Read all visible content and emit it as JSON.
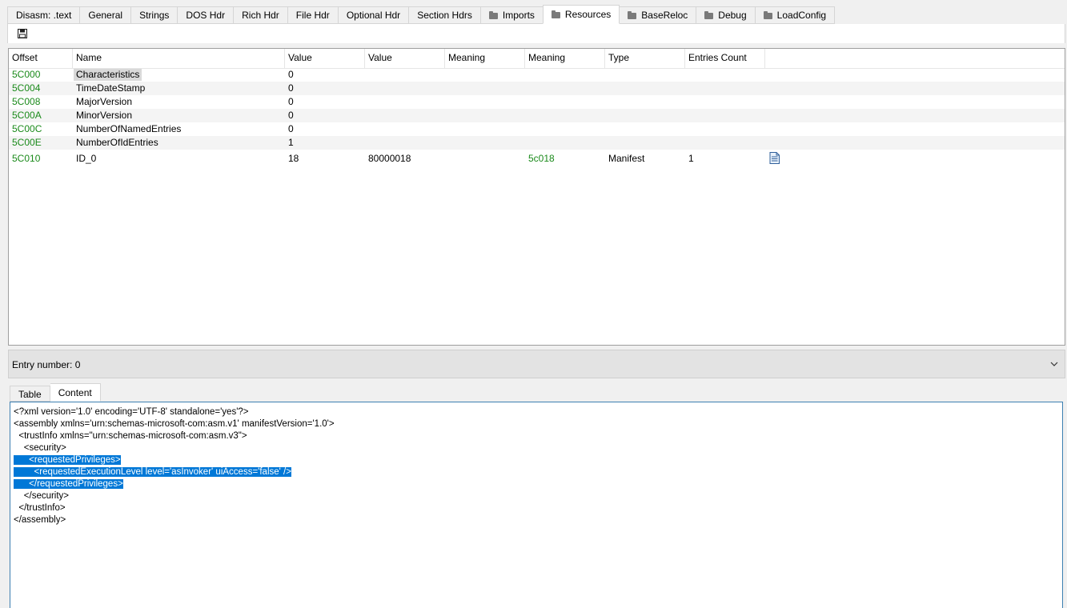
{
  "tabs": [
    {
      "label": "Disasm: .text",
      "folder": false,
      "active": false
    },
    {
      "label": "General",
      "folder": false,
      "active": false
    },
    {
      "label": "Strings",
      "folder": false,
      "active": false
    },
    {
      "label": "DOS Hdr",
      "folder": false,
      "active": false
    },
    {
      "label": "Rich Hdr",
      "folder": false,
      "active": false
    },
    {
      "label": "File Hdr",
      "folder": false,
      "active": false
    },
    {
      "label": "Optional Hdr",
      "folder": false,
      "active": false
    },
    {
      "label": "Section Hdrs",
      "folder": false,
      "active": false
    },
    {
      "label": "Imports",
      "folder": true,
      "active": false
    },
    {
      "label": "Resources",
      "folder": true,
      "active": true
    },
    {
      "label": "BaseReloc",
      "folder": true,
      "active": false
    },
    {
      "label": "Debug",
      "folder": true,
      "active": false
    },
    {
      "label": "LoadConfig",
      "folder": true,
      "active": false
    }
  ],
  "grid": {
    "columns": [
      "Offset",
      "Name",
      "Value",
      "Value",
      "Meaning",
      "Meaning",
      "Type",
      "Entries Count"
    ],
    "rows": [
      {
        "offset": "5C000",
        "name": "Characteristics",
        "value": "0",
        "value2": "",
        "meaning": "",
        "meaning2": "",
        "type": "",
        "entries": "",
        "icon": false,
        "selected": true
      },
      {
        "offset": "5C004",
        "name": "TimeDateStamp",
        "value": "0",
        "value2": "",
        "meaning": "",
        "meaning2": "",
        "type": "",
        "entries": "",
        "icon": false,
        "selected": false
      },
      {
        "offset": "5C008",
        "name": "MajorVersion",
        "value": "0",
        "value2": "",
        "meaning": "",
        "meaning2": "",
        "type": "",
        "entries": "",
        "icon": false,
        "selected": false
      },
      {
        "offset": "5C00A",
        "name": "MinorVersion",
        "value": "0",
        "value2": "",
        "meaning": "",
        "meaning2": "",
        "type": "",
        "entries": "",
        "icon": false,
        "selected": false
      },
      {
        "offset": "5C00C",
        "name": "NumberOfNamedEntries",
        "value": "0",
        "value2": "",
        "meaning": "",
        "meaning2": "",
        "type": "",
        "entries": "",
        "icon": false,
        "selected": false
      },
      {
        "offset": "5C00E",
        "name": "NumberOfIdEntries",
        "value": "1",
        "value2": "",
        "meaning": "",
        "meaning2": "",
        "type": "",
        "entries": "",
        "icon": false,
        "selected": false
      },
      {
        "offset": "5C010",
        "name": "ID_0",
        "value": "18",
        "value2": "80000018",
        "meaning": "",
        "meaning2": "5c018",
        "type": "Manifest",
        "entries": "1",
        "icon": true,
        "selected": false
      }
    ]
  },
  "entry": {
    "label": "Entry number: 0"
  },
  "subtabs": [
    {
      "label": "Table",
      "active": false
    },
    {
      "label": "Content",
      "active": true
    }
  ],
  "content": {
    "lines": [
      {
        "text": "<?xml version='1.0' encoding='UTF-8' standalone='yes'?>",
        "highlight": false
      },
      {
        "text": "<assembly xmlns='urn:schemas-microsoft-com:asm.v1' manifestVersion='1.0'>",
        "highlight": false
      },
      {
        "text": "  <trustInfo xmlns=\"urn:schemas-microsoft-com:asm.v3\">",
        "highlight": false
      },
      {
        "text": "    <security>",
        "highlight": false
      },
      {
        "text": "      <requestedPrivileges>",
        "highlight": true
      },
      {
        "text": "        <requestedExecutionLevel level='asInvoker' uiAccess='false' />",
        "highlight": true
      },
      {
        "text": "      </requestedPrivileges>",
        "highlight": true
      },
      {
        "text": "    </security>",
        "highlight": false
      },
      {
        "text": "  </trustInfo>",
        "highlight": false
      },
      {
        "text": "</assembly>",
        "highlight": false
      }
    ]
  },
  "colors": {
    "offset": "#1a8a1a",
    "selection": "#0078d7"
  }
}
